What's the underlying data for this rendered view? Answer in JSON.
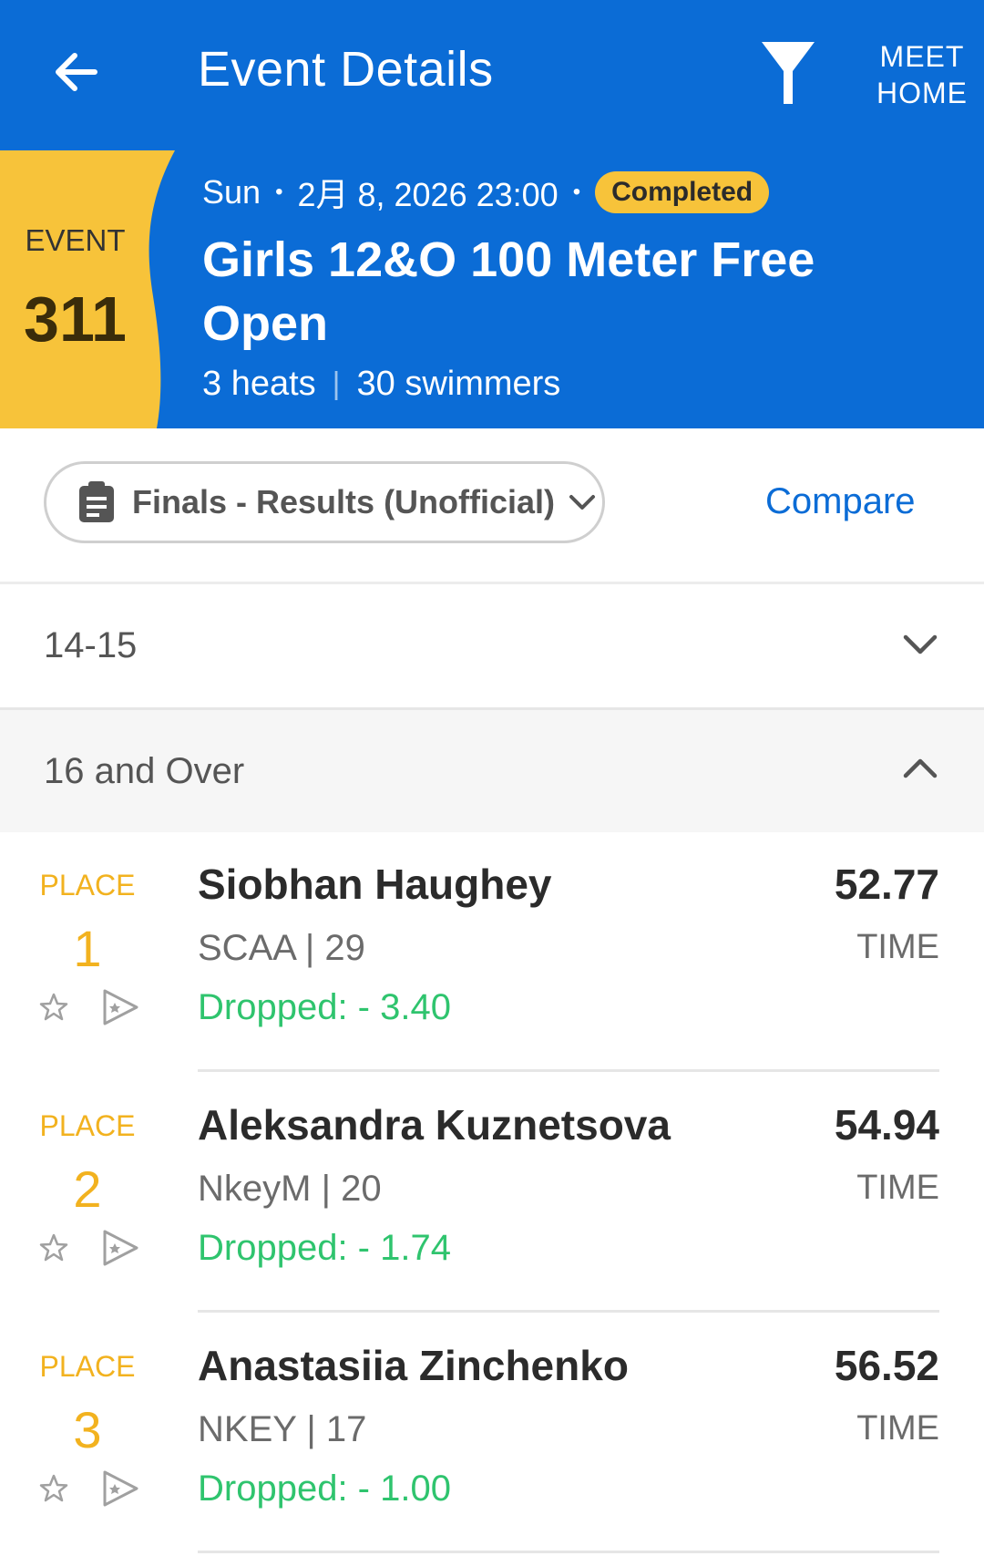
{
  "header": {
    "title": "Event Details",
    "meet_home_line1": "MEET",
    "meet_home_line2": "HOME"
  },
  "event": {
    "label": "EVENT",
    "number": "311",
    "day": "Sun",
    "datetime": "2月 8, 2026 23:00",
    "status": "Completed",
    "title": "Girls 12&O 100 Meter Free Open",
    "heats": "3 heats",
    "swimmers": "30 swimmers"
  },
  "session": {
    "label": "Finals - Results (Unofficial)",
    "compare": "Compare"
  },
  "groups": [
    {
      "label": "14-15",
      "expanded": false
    },
    {
      "label": "16 and Over",
      "expanded": true
    }
  ],
  "results": [
    {
      "place_label": "PLACE",
      "place": "1",
      "name": "Siobhan Haughey",
      "team_age": "SCAA | 29",
      "dropped": "Dropped: - 3.40",
      "time": "52.77",
      "time_label": "TIME"
    },
    {
      "place_label": "PLACE",
      "place": "2",
      "name": "Aleksandra Kuznetsova",
      "team_age": "NkeyM | 20",
      "dropped": "Dropped: - 1.74",
      "time": "54.94",
      "time_label": "TIME"
    },
    {
      "place_label": "PLACE",
      "place": "3",
      "name": "Anastasiia Zinchenko",
      "team_age": "NKEY | 17",
      "dropped": "Dropped: - 1.00",
      "time": "56.52",
      "time_label": "TIME"
    }
  ],
  "colors": {
    "brand_blue": "#0b6cd6",
    "accent_yellow": "#f7c33a",
    "place_orange": "#f2b21f",
    "drop_green": "#2fc46e"
  },
  "icons": [
    "back-arrow-icon",
    "filter-funnel-icon",
    "clipboard-icon",
    "chevron-down-icon",
    "chevron-up-icon",
    "star-outline-icon",
    "flag-icon"
  ]
}
